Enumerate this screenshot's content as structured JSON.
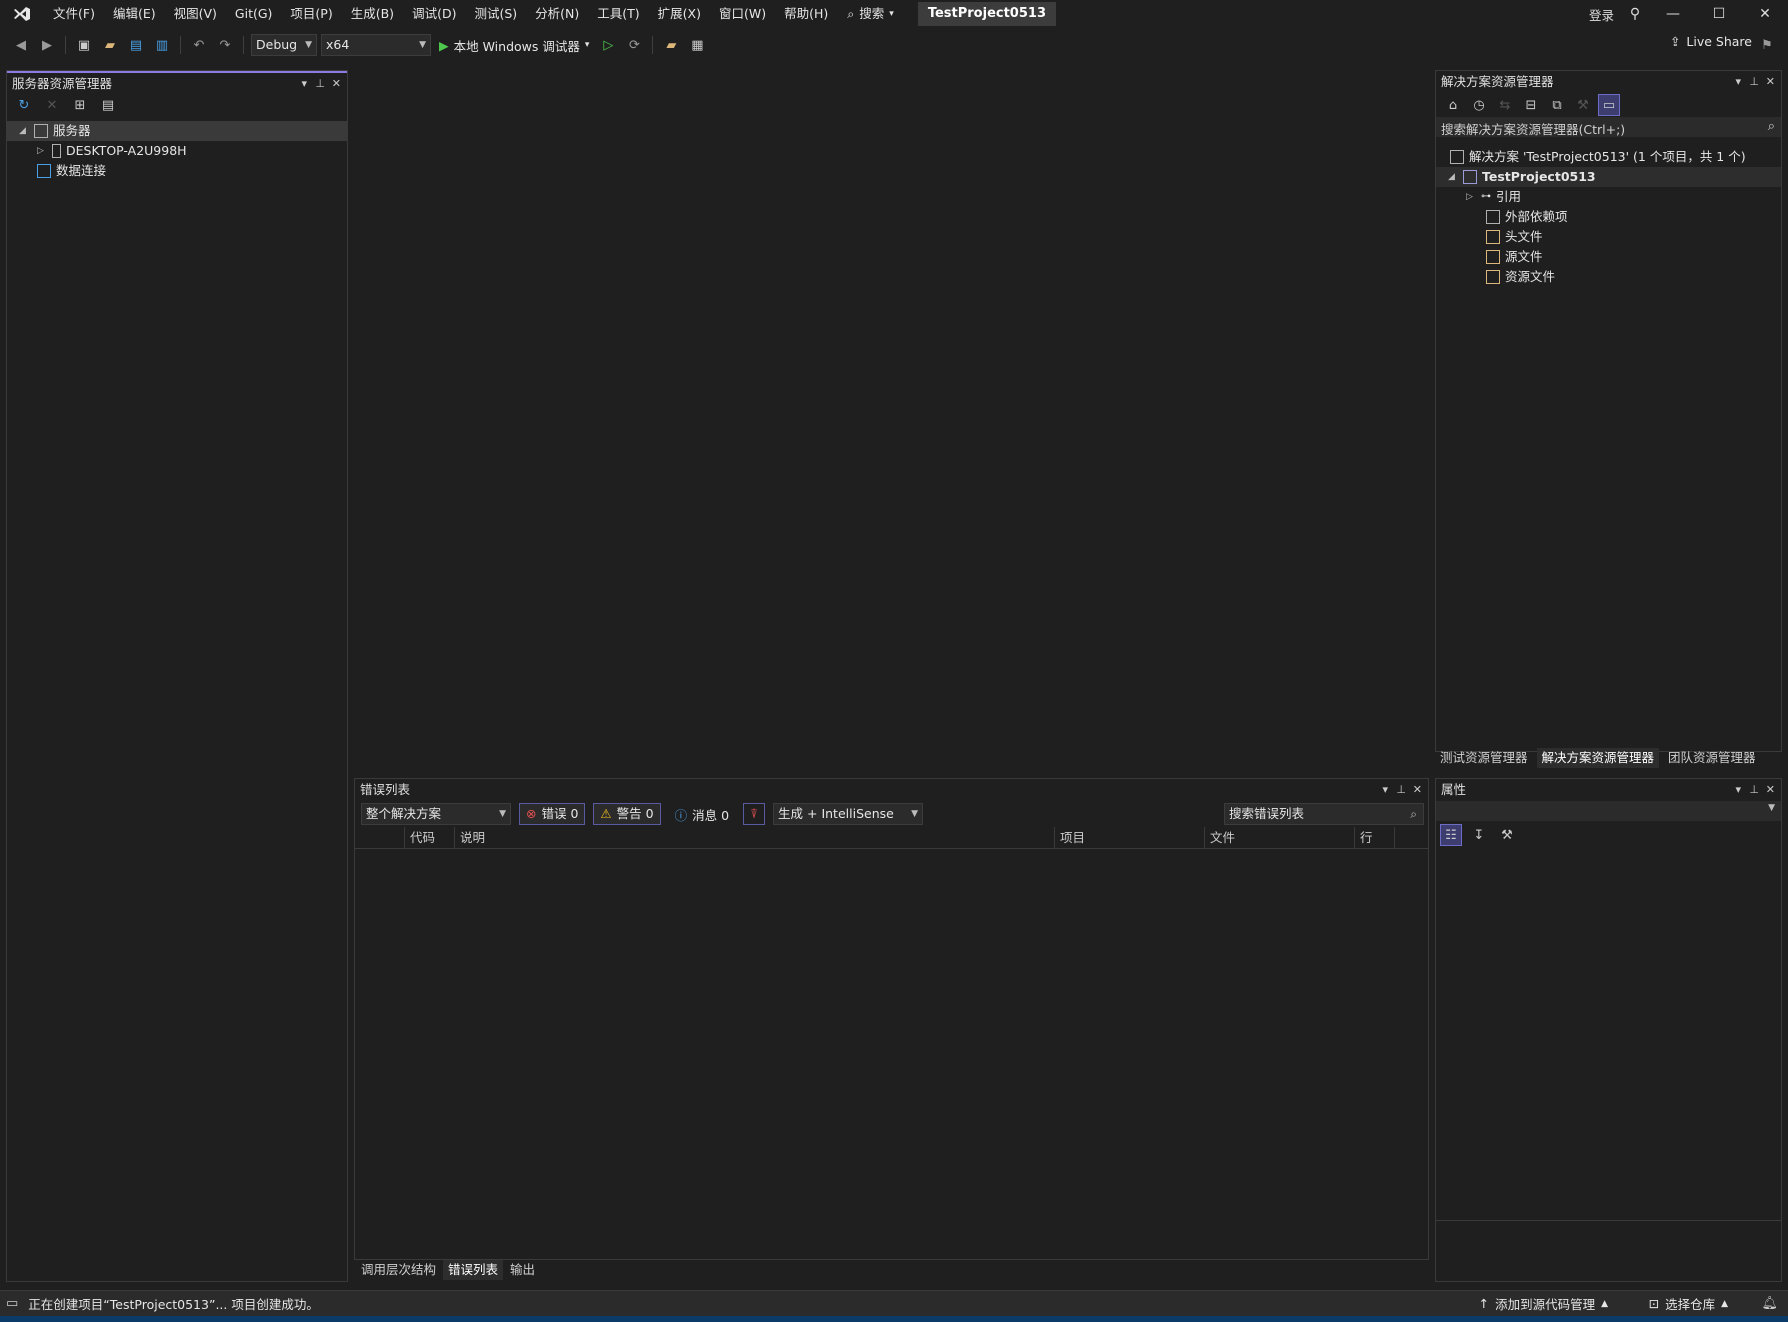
{
  "menubar": {
    "items": [
      "文件(F)",
      "编辑(E)",
      "视图(V)",
      "Git(G)",
      "项目(P)",
      "生成(B)",
      "调试(D)",
      "测试(S)",
      "分析(N)",
      "工具(T)",
      "扩展(X)",
      "窗口(W)",
      "帮助(H)"
    ],
    "search_label": "搜索",
    "project_name": "TestProject0513",
    "login_label": "登录"
  },
  "toolbar": {
    "config": "Debug",
    "platform": "x64",
    "debug_target": "本地 Windows 调试器",
    "live_share": "Live Share"
  },
  "server_explorer": {
    "title": "服务器资源管理器",
    "nodes": [
      "服务器",
      "DESKTOP-A2U998H",
      "数据连接"
    ]
  },
  "solution_explorer": {
    "title": "解决方案资源管理器",
    "search_placeholder": "搜索解决方案资源管理器(Ctrl+;)",
    "solution_label": "解决方案 'TestProject0513' (1 个项目，共 1 个)",
    "project_label": "TestProject0513",
    "children": [
      "引用",
      "外部依赖项",
      "头文件",
      "源文件",
      "资源文件"
    ],
    "tabs": [
      "测试资源管理器",
      "解决方案资源管理器",
      "团队资源管理器"
    ],
    "active_tab": "解决方案资源管理器"
  },
  "error_list": {
    "title": "错误列表",
    "scope": "整个解决方案",
    "errors_label": "错误 0",
    "warnings_label": "警告 0",
    "messages_label": "消息 0",
    "build_filter": "生成 + IntelliSense",
    "search_placeholder": "搜索错误列表",
    "columns": [
      "代码",
      "说明",
      "项目",
      "文件",
      "行"
    ],
    "tabs": [
      "调用层次结构",
      "错误列表",
      "输出"
    ]
  },
  "properties": {
    "title": "属性"
  },
  "statusbar": {
    "message": "正在创建项目“TestProject0513”... 项目创建成功。",
    "source_control": "添加到源代码管理",
    "repo": "选择仓库"
  }
}
